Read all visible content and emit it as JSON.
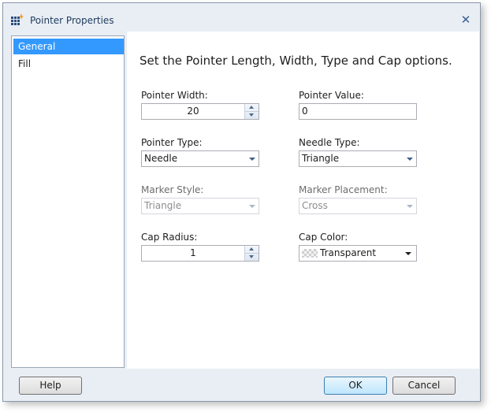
{
  "window": {
    "title": "Pointer Properties"
  },
  "icons": {
    "app": "app-grid-icon",
    "close": "close-icon"
  },
  "colors": {
    "selection": "#3399ff",
    "window_bg": "#e9eef5",
    "title_text": "#1e395b"
  },
  "sidebar": {
    "items": [
      {
        "label": "General",
        "selected": true
      },
      {
        "label": "Fill",
        "selected": false
      }
    ]
  },
  "main": {
    "heading": "Set the Pointer Length, Width, Type and Cap options.",
    "pointer_width": {
      "label": "Pointer Width:",
      "value": "20"
    },
    "pointer_value": {
      "label": "Pointer Value:",
      "value": "0"
    },
    "pointer_type": {
      "label": "Pointer Type:",
      "value": "Needle"
    },
    "needle_type": {
      "label": "Needle Type:",
      "value": "Triangle"
    },
    "marker_style": {
      "label": "Marker Style:",
      "value": "Triangle",
      "enabled": false
    },
    "marker_placement": {
      "label": "Marker Placement:",
      "value": "Cross",
      "enabled": false
    },
    "cap_radius": {
      "label": "Cap Radius:",
      "value": "1"
    },
    "cap_color": {
      "label": "Cap Color:",
      "value": "Transparent"
    }
  },
  "footer": {
    "help": "Help",
    "ok": "OK",
    "cancel": "Cancel"
  }
}
